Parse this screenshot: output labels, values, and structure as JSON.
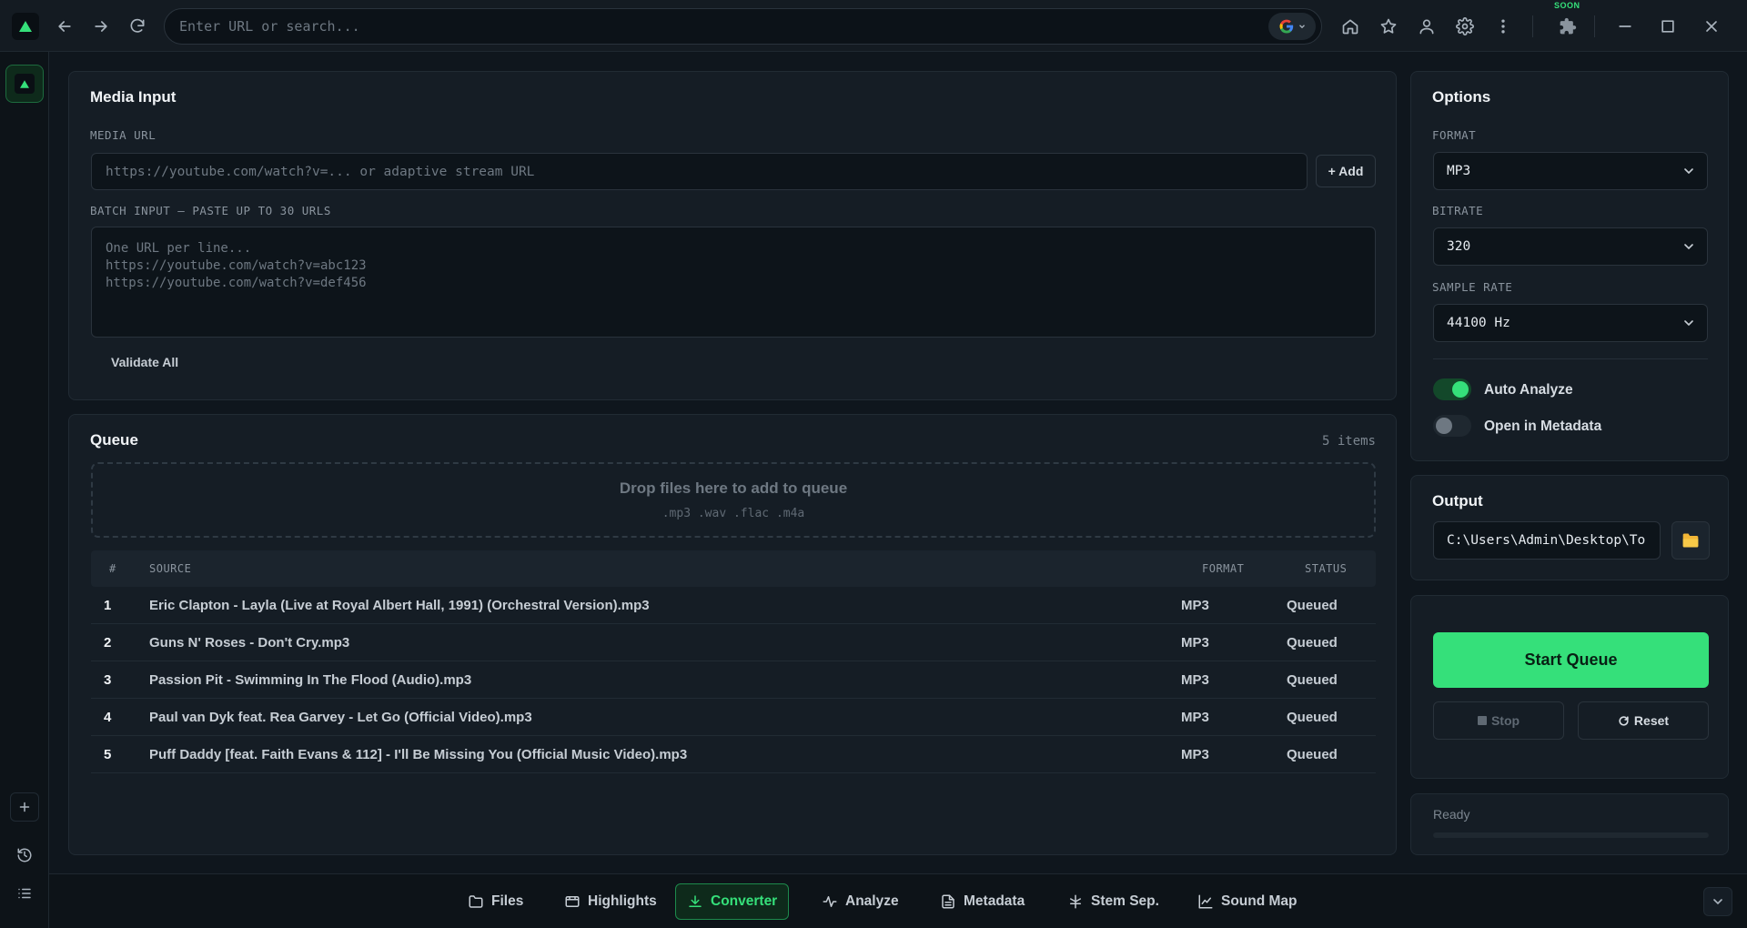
{
  "browser": {
    "url_placeholder": "Enter URL or search...",
    "search_engine": "google-icon",
    "soon_badge": "SOON"
  },
  "colors": {
    "accent": "#35e07a",
    "background": "#0f161d",
    "panel": "#151d25"
  },
  "media_input": {
    "title": "Media Input",
    "url_label": "MEDIA URL",
    "url_placeholder": "https://youtube.com/watch?v=... or adaptive stream URL",
    "add_label": "+ Add",
    "batch_label": "BATCH INPUT — PASTE UP TO 30 URLS",
    "batch_placeholder": "One URL per line...\nhttps://youtube.com/watch?v=abc123\nhttps://youtube.com/watch?v=def456",
    "validate_label": "Validate All"
  },
  "queue": {
    "title": "Queue",
    "count": "5 items",
    "drop_title": "Drop files here to add to queue",
    "drop_exts": ".mp3 .wav .flac .m4a",
    "columns": [
      "#",
      "SOURCE",
      "FORMAT",
      "STATUS"
    ],
    "rows": [
      {
        "num": "1",
        "source": "Eric Clapton - Layla (Live at Royal Albert Hall, 1991) (Orchestral Version).mp3",
        "format": "MP3",
        "status": "Queued"
      },
      {
        "num": "2",
        "source": "Guns N' Roses - Don't Cry.mp3",
        "format": "MP3",
        "status": "Queued"
      },
      {
        "num": "3",
        "source": "Passion Pit - Swimming In The Flood (Audio).mp3",
        "format": "MP3",
        "status": "Queued"
      },
      {
        "num": "4",
        "source": "Paul van Dyk feat. Rea Garvey - Let Go (Official Video).mp3",
        "format": "MP3",
        "status": "Queued"
      },
      {
        "num": "5",
        "source": "Puff Daddy [feat. Faith Evans & 112] - I'll Be Missing You (Official Music Video).mp3",
        "format": "MP3",
        "status": "Queued"
      }
    ]
  },
  "options": {
    "title": "Options",
    "format_label": "FORMAT",
    "format_value": "MP3",
    "bitrate_label": "BITRATE",
    "bitrate_value": "320",
    "sample_rate_label": "SAMPLE RATE",
    "sample_rate_value": "44100 Hz",
    "auto_analyze_label": "Auto Analyze",
    "auto_analyze_on": true,
    "open_metadata_label": "Open in Metadata",
    "open_metadata_on": false
  },
  "output": {
    "title": "Output",
    "path": "C:\\Users\\Admin\\Desktop\\To"
  },
  "actions": {
    "start_label": "Start Queue",
    "stop_label": "Stop",
    "reset_label": "Reset"
  },
  "status": {
    "text": "Ready",
    "progress": 0
  },
  "bottom_nav": {
    "tabs": [
      {
        "label": "Files",
        "icon": "folder-icon"
      },
      {
        "label": "Highlights",
        "icon": "film-icon"
      },
      {
        "label": "Converter",
        "icon": "download-icon",
        "active": true
      },
      {
        "label": "Analyze",
        "icon": "waveform-icon"
      },
      {
        "label": "Metadata",
        "icon": "document-icon"
      },
      {
        "label": "Stem Sep.",
        "icon": "split-icon"
      },
      {
        "label": "Sound Map",
        "icon": "scatter-chart-icon"
      }
    ]
  }
}
